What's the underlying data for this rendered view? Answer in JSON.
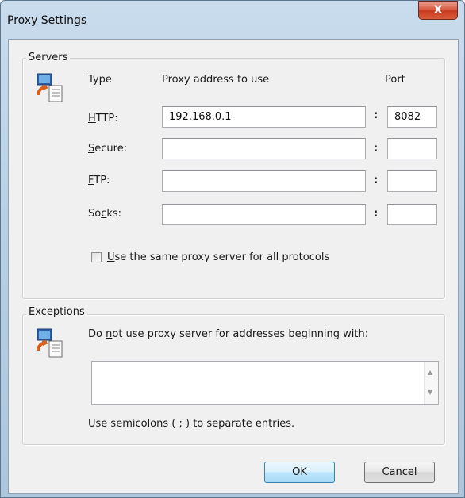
{
  "window": {
    "title": "Proxy Settings",
    "close_glyph": "X"
  },
  "servers": {
    "group_label": "Servers",
    "icon": "network-computer-icon",
    "headers": {
      "type": "Type",
      "address": "Proxy address to use",
      "port": "Port"
    },
    "rows": [
      {
        "key": "http",
        "label_underline": "H",
        "label_rest": "TTP:",
        "label_pre": "",
        "address": "192.168.0.1",
        "port": "8082"
      },
      {
        "key": "secure",
        "label_underline": "S",
        "label_rest": "ecure:",
        "label_pre": "",
        "address": "",
        "port": ""
      },
      {
        "key": "ftp",
        "label_underline": "F",
        "label_rest": "TP:",
        "label_pre": "",
        "address": "",
        "port": ""
      },
      {
        "key": "socks",
        "label_underline": "c",
        "label_rest": "ks:",
        "label_pre": "So",
        "address": "",
        "port": ""
      }
    ],
    "colon": ":",
    "same_proxy": {
      "underline": "U",
      "rest": "se the same proxy server for all protocols",
      "checked": false
    }
  },
  "exceptions": {
    "group_label": "Exceptions",
    "icon": "network-computer-icon",
    "prompt_pre": "Do ",
    "prompt_underline": "n",
    "prompt_rest": "ot use proxy server for addresses beginning with:",
    "value": "",
    "hint": "Use semicolons ( ; ) to separate entries."
  },
  "buttons": {
    "ok": "OK",
    "cancel": "Cancel"
  },
  "colors": {
    "accent": "#3c7fb1",
    "close": "#c63a1d"
  }
}
